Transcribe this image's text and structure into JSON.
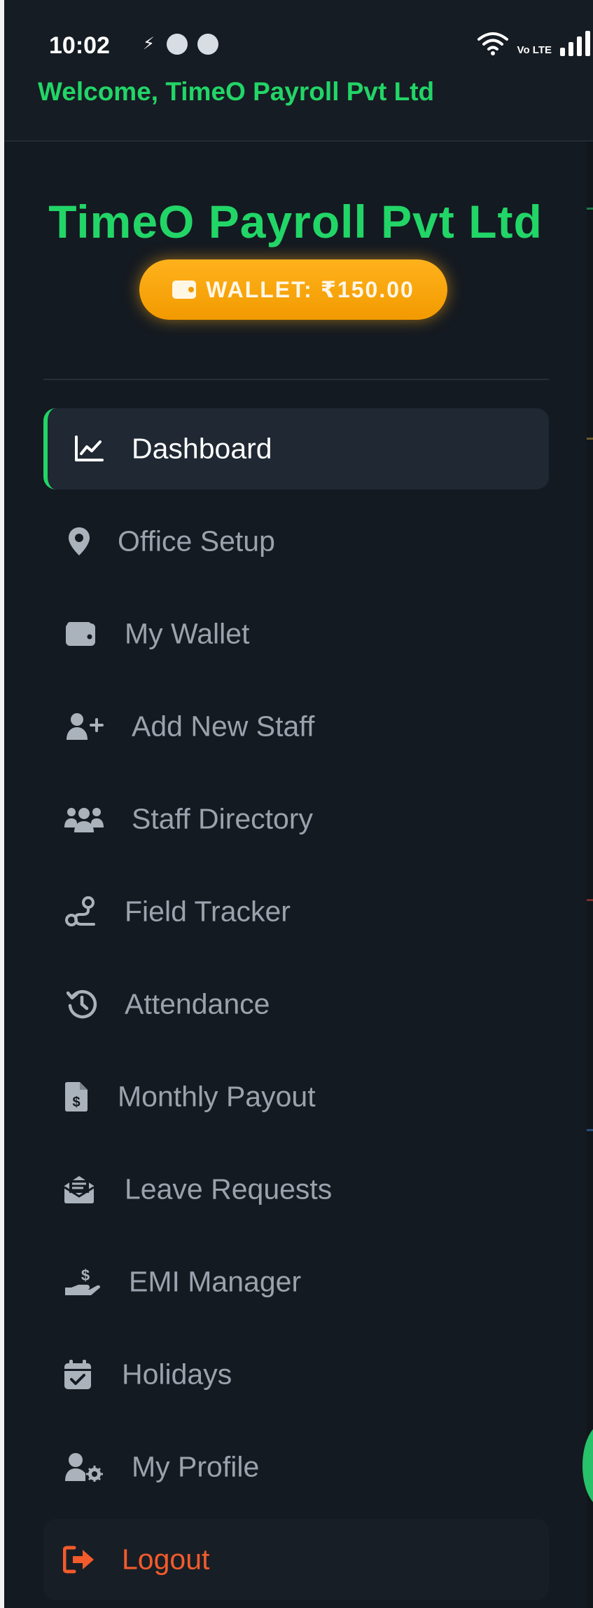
{
  "status_bar": {
    "time": "10:02",
    "network": "Vo LTE"
  },
  "header": {
    "welcome": "Welcome, TimeO Payroll Pvt Ltd"
  },
  "drawer": {
    "company_name": "TimeO Payroll Pvt Ltd",
    "wallet_label": "WALLET: ₹150.00",
    "active_item": "Dashboard",
    "items": [
      {
        "label": "Dashboard",
        "icon": "chart-line-icon"
      },
      {
        "label": "Office Setup",
        "icon": "map-pin-icon"
      },
      {
        "label": "My Wallet",
        "icon": "wallet-icon"
      },
      {
        "label": "Add New Staff",
        "icon": "user-plus-icon"
      },
      {
        "label": "Staff Directory",
        "icon": "users-icon"
      },
      {
        "label": "Field Tracker",
        "icon": "route-icon"
      },
      {
        "label": "Attendance",
        "icon": "history-icon"
      },
      {
        "label": "Monthly Payout",
        "icon": "invoice-dollar-icon"
      },
      {
        "label": "Leave Requests",
        "icon": "envelope-open-icon"
      },
      {
        "label": "EMI Manager",
        "icon": "hand-holding-dollar-icon"
      },
      {
        "label": "Holidays",
        "icon": "calendar-check-icon"
      },
      {
        "label": "My Profile",
        "icon": "user-gear-icon"
      }
    ],
    "logout_label": "Logout"
  },
  "colors": {
    "accent_green": "#22d567",
    "wallet_orange": "#f29a00",
    "logout_red": "#f25b2b",
    "drawer_bg": "#141a21",
    "muted_text": "#9aa3ad"
  }
}
